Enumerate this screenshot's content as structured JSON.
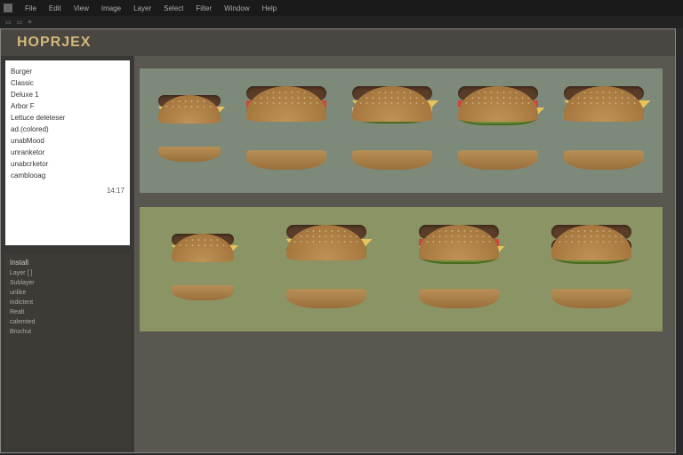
{
  "menubar": {
    "items": [
      "File",
      "Edit",
      "View",
      "Image",
      "Layer",
      "Select",
      "Filter",
      "Window",
      "Help"
    ]
  },
  "app": {
    "title": "HOPRJEX"
  },
  "panel": {
    "items": [
      "Burger",
      "Classic",
      "Deluxe 1",
      "Arbor F",
      "Lettuce deleteser",
      "ad.(colored)",
      "unabMood",
      "unranketor",
      "unabcrketor",
      "camblooag"
    ],
    "footer": "14:17"
  },
  "lower": {
    "header": "Install",
    "rows": [
      "Layer  [ ]",
      "Sublayer",
      "unlike",
      "indictent",
      "Realt",
      "calemted",
      "Brochut"
    ]
  },
  "strips": {
    "count_top": 5,
    "count_bottom": 4
  },
  "colors": {
    "bg_top": "#7d8a7a",
    "bg_bottom": "#8a9464",
    "canvas": "#5a5650"
  }
}
